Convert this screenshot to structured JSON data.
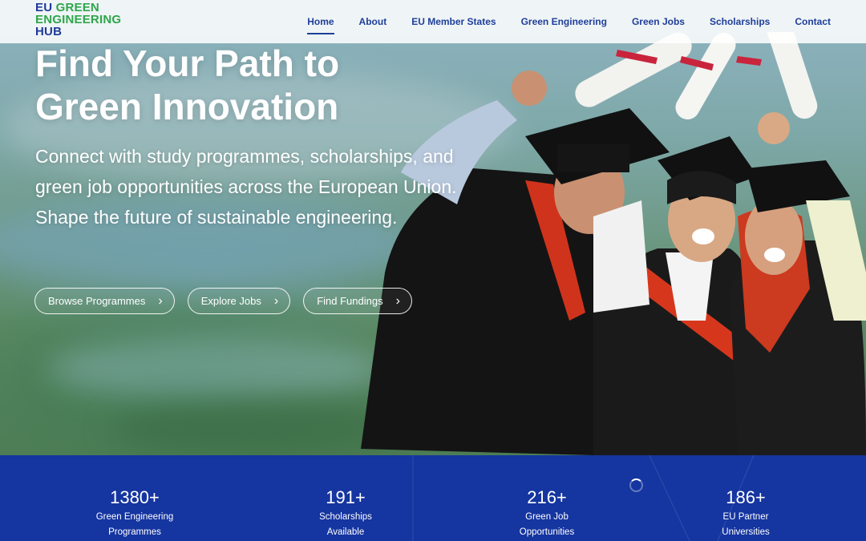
{
  "header": {
    "logo": {
      "line1_a": "EU ",
      "line1_b": "GREEN",
      "line2": "ENGINEERING",
      "line3": "HUB"
    },
    "nav": [
      {
        "label": "Home",
        "active": true
      },
      {
        "label": "About"
      },
      {
        "label": "EU Member States"
      },
      {
        "label": "Green Engineering"
      },
      {
        "label": "Green Jobs"
      },
      {
        "label": "Scholarships"
      },
      {
        "label": "Contact"
      }
    ]
  },
  "hero": {
    "title": "Find Your Path to Green Innovation",
    "subtitle": "Connect with study programmes, scholarships, and green job opportunities across the European Union. Shape the future of sustainable engineering.",
    "buttons": [
      {
        "label": "Browse Programmes",
        "icon": "chevron-right-icon"
      },
      {
        "label": "Explore Jobs",
        "icon": "chevron-right-icon"
      },
      {
        "label": "Find Fundings",
        "icon": "chevron-right-icon"
      }
    ]
  },
  "stats": [
    {
      "value": "1380+",
      "label_line1": "Green Engineering",
      "label_line2": "Programmes"
    },
    {
      "value": "191+",
      "label_line1": "Scholarships",
      "label_line2": "Available"
    },
    {
      "value": "216+",
      "label_line1": "Green Job",
      "label_line2": "Opportunities"
    },
    {
      "value": "186+",
      "label_line1": "EU Partner",
      "label_line2": "Universities"
    }
  ],
  "colors": {
    "brand_blue": "#1f3a9a",
    "brand_green": "#2ea64a",
    "stats_bg": "#1535a0"
  }
}
